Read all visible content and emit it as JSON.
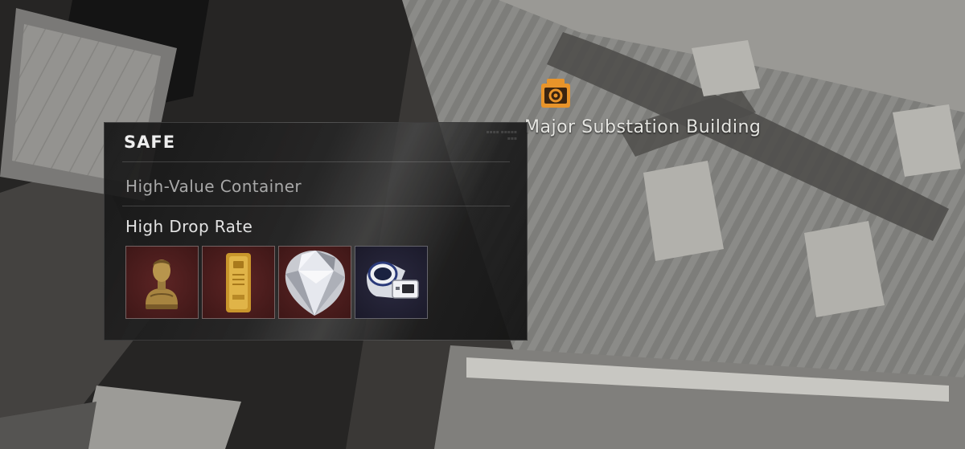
{
  "map": {
    "location_name": "Major Substation Building",
    "location_icon": "camera-icon",
    "accent_color": "#e8942a"
  },
  "tooltip": {
    "title": "SAFE",
    "category": "High-Value Container",
    "drop_heading": "High Drop Rate",
    "items": [
      {
        "icon": "bronze-bust-icon",
        "rarity_color": "#4a1c1c"
      },
      {
        "icon": "gold-bar-icon",
        "rarity_color": "#4a1c1c"
      },
      {
        "icon": "diamond-icon",
        "rarity_color": "#4a1c1c"
      },
      {
        "icon": "medical-device-icon",
        "rarity_color": "#23222f"
      }
    ]
  }
}
